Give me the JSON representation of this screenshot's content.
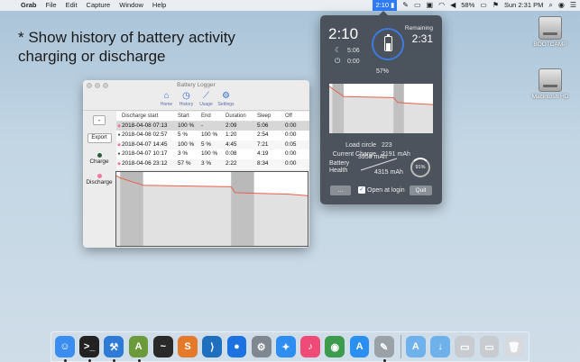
{
  "menubar": {
    "app_name": "Grab",
    "menus": [
      "File",
      "Edit",
      "Capture",
      "Window",
      "Help"
    ],
    "battery_item": "2:10",
    "battery_percent": "58%",
    "clock": "Sun 2:31 PM"
  },
  "annotation": {
    "line1": "* Show history of battery activity",
    "line2": "charging or discharge"
  },
  "desktop": {
    "drives": [
      {
        "label": "BOOTCAMP"
      },
      {
        "label": "Macintosh HD"
      }
    ]
  },
  "window": {
    "title": "Battery Logger",
    "toolbar": [
      {
        "label": "Home",
        "icon": "house-icon"
      },
      {
        "label": "History",
        "icon": "clock-icon"
      },
      {
        "label": "Usage",
        "icon": "chart-icon"
      },
      {
        "label": "Settings",
        "icon": "gear-icon"
      }
    ],
    "sidebar": {
      "minus_label": "-",
      "export_label": "Export",
      "charge_label": "Charge",
      "discharge_label": "Discharge"
    },
    "table": {
      "headers": [
        "Discharge start",
        "Start",
        "End",
        "Duration",
        "Sleep",
        "Off"
      ],
      "rows": [
        {
          "kind": "discharge",
          "start": "2018-04-08 07:13",
          "s": "100 %",
          "e": "-",
          "d": "2:09",
          "sleep": "5:06",
          "off": "0:00"
        },
        {
          "kind": "charge",
          "start": "2018-04-08 02:57",
          "s": "5 %",
          "e": "100 %",
          "d": "1:20",
          "sleep": "2:54",
          "off": "0:00"
        },
        {
          "kind": "discharge",
          "start": "2018-04-07 14:45",
          "s": "100 %",
          "e": "5 %",
          "d": "4:45",
          "sleep": "7:21",
          "off": "0:05"
        },
        {
          "kind": "charge",
          "start": "2018-04-07 10:17",
          "s": "3 %",
          "e": "100 %",
          "d": "0:08",
          "sleep": "4:19",
          "off": "0:00"
        },
        {
          "kind": "discharge",
          "start": "2018-04-06 23:12",
          "s": "57 %",
          "e": "3 %",
          "d": "2:22",
          "sleep": "8:34",
          "off": "0:00"
        }
      ]
    }
  },
  "popover": {
    "time": "2:10",
    "sleep_time": "5:06",
    "off_time": "0:00",
    "percent": "57%",
    "remaining_label": "Remaining",
    "remaining_value": "2:31",
    "load_cycle_label": "Load circle",
    "load_cycle_value": "223",
    "current_charge_label": "Current Charge",
    "current_charge_value": "2191 mAh",
    "health_label_1": "Battery",
    "health_label_2": "Health",
    "design_capacity": "3958 mAh",
    "full_capacity": "4315 mAh",
    "health_percent": "91%",
    "more_button": "...",
    "open_at_login": "Open at login",
    "quit_button": "Quit"
  },
  "dock": {
    "apps": [
      {
        "name": "finder-icon",
        "color": "#3b8ef0",
        "glyph": "☺"
      },
      {
        "name": "terminal-icon",
        "color": "#222222",
        "glyph": ">_"
      },
      {
        "name": "xcode-icon",
        "color": "#2d7bd6",
        "glyph": "⚒"
      },
      {
        "name": "android-studio-icon",
        "color": "#6b9a3a",
        "glyph": "A"
      },
      {
        "name": "activity-monitor-icon",
        "color": "#2a2a2a",
        "glyph": "~"
      },
      {
        "name": "sublime-text-icon",
        "color": "#e5792a",
        "glyph": "S"
      },
      {
        "name": "vscode-icon",
        "color": "#1f6fbf",
        "glyph": "⟩"
      },
      {
        "name": "maps-pin-icon",
        "color": "#1c72e0",
        "glyph": "●"
      },
      {
        "name": "system-preferences-icon",
        "color": "#7f8790",
        "glyph": "⚙"
      },
      {
        "name": "safari-icon",
        "color": "#2e8df0",
        "glyph": "✦"
      },
      {
        "name": "itunes-icon",
        "color": "#f04a78",
        "glyph": "♪"
      },
      {
        "name": "chrome-icon",
        "color": "#3c9b4c",
        "glyph": "◉"
      },
      {
        "name": "app-store-icon",
        "color": "#2a8ff0",
        "glyph": "A"
      },
      {
        "name": "preview-icon",
        "color": "#9aa2a8",
        "glyph": "✎"
      }
    ],
    "folders": [
      {
        "name": "applications-folder-icon",
        "color": "#6fb1ea",
        "glyph": "A"
      },
      {
        "name": "downloads-folder-icon",
        "color": "#6fb1ea",
        "glyph": "↓"
      },
      {
        "name": "drive-stack-icon",
        "color": "#c8ccd0",
        "glyph": "▭"
      },
      {
        "name": "drive-stack-2-icon",
        "color": "#c8ccd0",
        "glyph": "▭"
      },
      {
        "name": "trash-icon",
        "color": "#d6dade",
        "glyph": "🗑"
      }
    ]
  },
  "colors": {
    "accent": "#2f7cf6",
    "chart_line": "#e8604c",
    "charge_mark": "#2b5d3a",
    "discharge_mark": "#f07a9a"
  }
}
